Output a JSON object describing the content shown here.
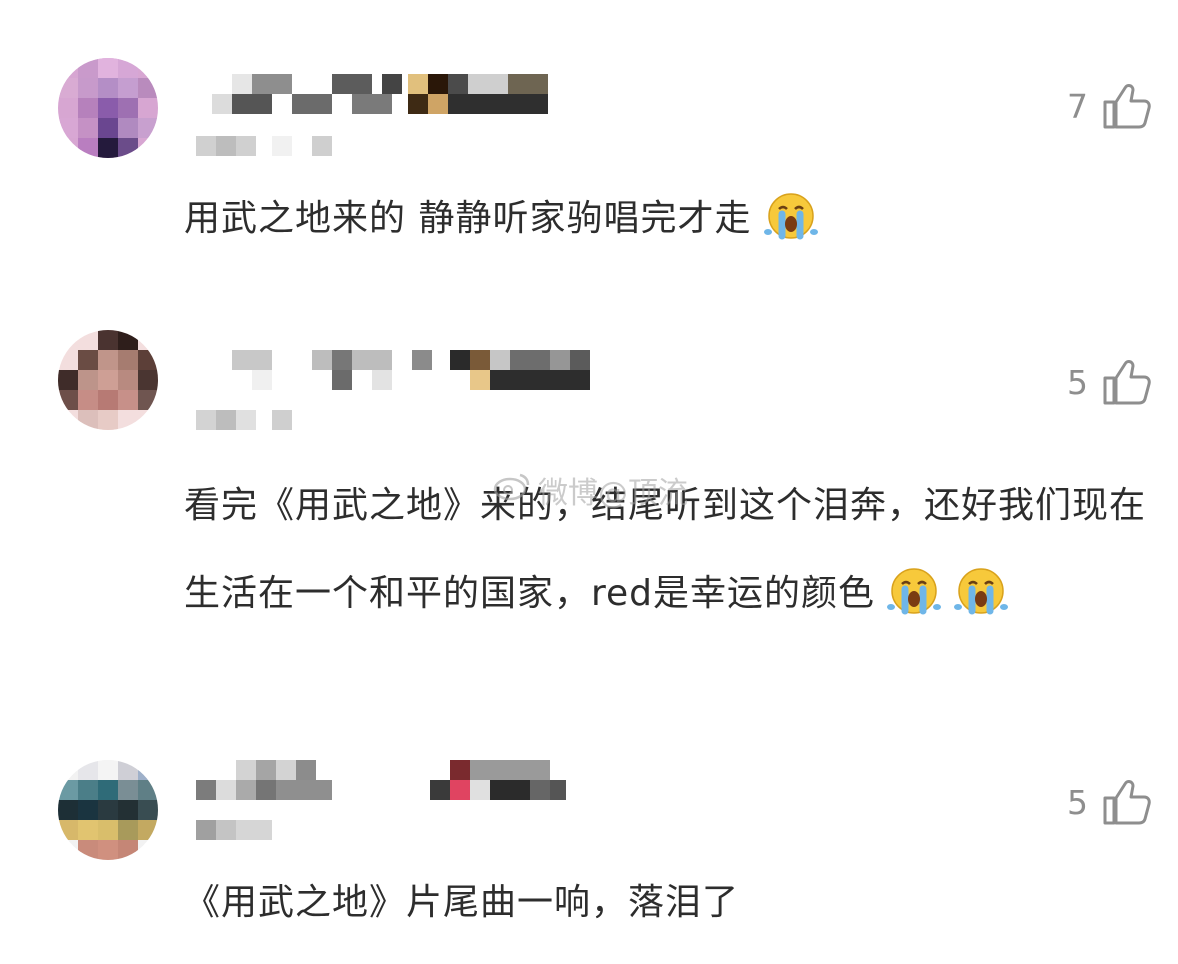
{
  "comments": [
    {
      "likes": "7",
      "text": "用武之地来的 静静听家驹唱完才走",
      "emoji_count": 1
    },
    {
      "likes": "5",
      "text": "看完《用武之地》来的，结尾听到这个泪奔，还好我们现在生活在一个和平的国家，red是幸运的颜色",
      "emoji_count": 2
    },
    {
      "likes": "5",
      "text": "《用武之地》片尾曲一响，落泪了",
      "emoji_count": 0
    }
  ],
  "watermark": "微博@顶流",
  "icons": {
    "like": "thumbs-up-icon",
    "emoji": "crying-face-icon",
    "watermark_logo": "weibo-logo-icon"
  },
  "colors": {
    "text": "#2d2d2d",
    "muted": "#8e8e8e",
    "emoji_face": "#f7c93b",
    "emoji_tear": "#6fb6e8"
  }
}
